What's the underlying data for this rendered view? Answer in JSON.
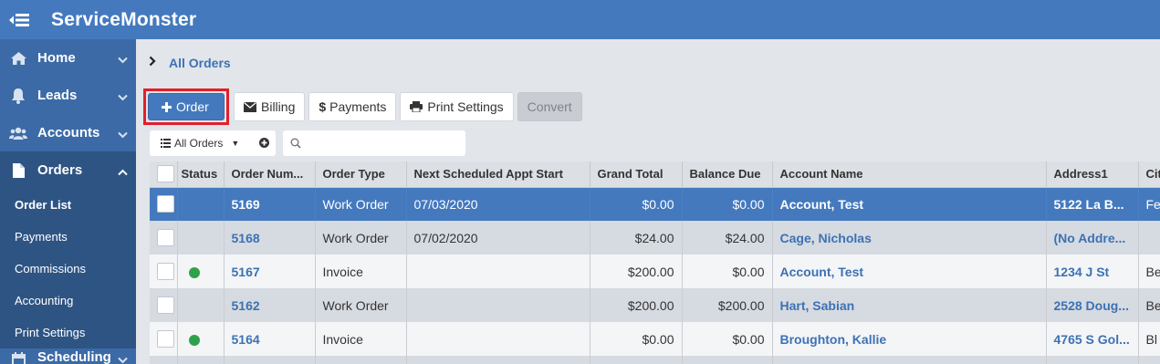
{
  "app": {
    "title": "ServiceMonster"
  },
  "sidebar": {
    "items": [
      {
        "label": "Home"
      },
      {
        "label": "Leads"
      },
      {
        "label": "Accounts"
      },
      {
        "label": "Orders"
      },
      {
        "label": "Scheduling"
      }
    ],
    "orders_subitems": [
      {
        "label": "Order List"
      },
      {
        "label": "Payments"
      },
      {
        "label": "Commissions"
      },
      {
        "label": "Accounting"
      },
      {
        "label": "Print Settings"
      }
    ]
  },
  "breadcrumb": {
    "current": "All Orders"
  },
  "toolbar": {
    "order_label": "Order",
    "billing_label": "Billing",
    "payments_label": "Payments",
    "print_settings_label": "Print Settings",
    "convert_label": "Convert"
  },
  "filter": {
    "view_label": "All Orders",
    "search_value": ""
  },
  "table": {
    "headers": {
      "status": "Status",
      "order_number": "Order Num...",
      "order_type": "Order Type",
      "next_appt": "Next Scheduled Appt Start",
      "grand_total": "Grand Total",
      "balance_due": "Balance Due",
      "account_name": "Account Name",
      "address1": "Address1",
      "city": "Cit"
    },
    "rows": [
      {
        "status": "",
        "order_number": "5169",
        "order_type": "Work Order",
        "next_appt": "07/03/2020",
        "grand_total": "$0.00",
        "balance_due": "$0.00",
        "account_name": "Account, Test",
        "address1": "5122 La B...",
        "city": "Fe"
      },
      {
        "status": "",
        "order_number": "5168",
        "order_type": "Work Order",
        "next_appt": "07/02/2020",
        "grand_total": "$24.00",
        "balance_due": "$24.00",
        "account_name": "Cage, Nicholas",
        "address1": "(No Addre...",
        "city": ""
      },
      {
        "status": "green",
        "order_number": "5167",
        "order_type": "Invoice",
        "next_appt": "",
        "grand_total": "$200.00",
        "balance_due": "$0.00",
        "account_name": "Account, Test",
        "address1": "1234 J St",
        "city": "Be"
      },
      {
        "status": "",
        "order_number": "5162",
        "order_type": "Work Order",
        "next_appt": "",
        "grand_total": "$200.00",
        "balance_due": "$200.00",
        "account_name": "Hart, Sabian",
        "address1": "2528 Doug...",
        "city": "Be"
      },
      {
        "status": "green",
        "order_number": "5164",
        "order_type": "Invoice",
        "next_appt": "",
        "grand_total": "$0.00",
        "balance_due": "$0.00",
        "account_name": "Broughton, Kallie",
        "address1": "4765 S Gol...",
        "city": "Bl"
      }
    ]
  },
  "colors": {
    "brand": "#4479be",
    "sidebar": "#3c6aa6",
    "sidebar_active": "#2e5483",
    "highlight_border": "#e21f2b",
    "status_green": "#2ea24a"
  }
}
